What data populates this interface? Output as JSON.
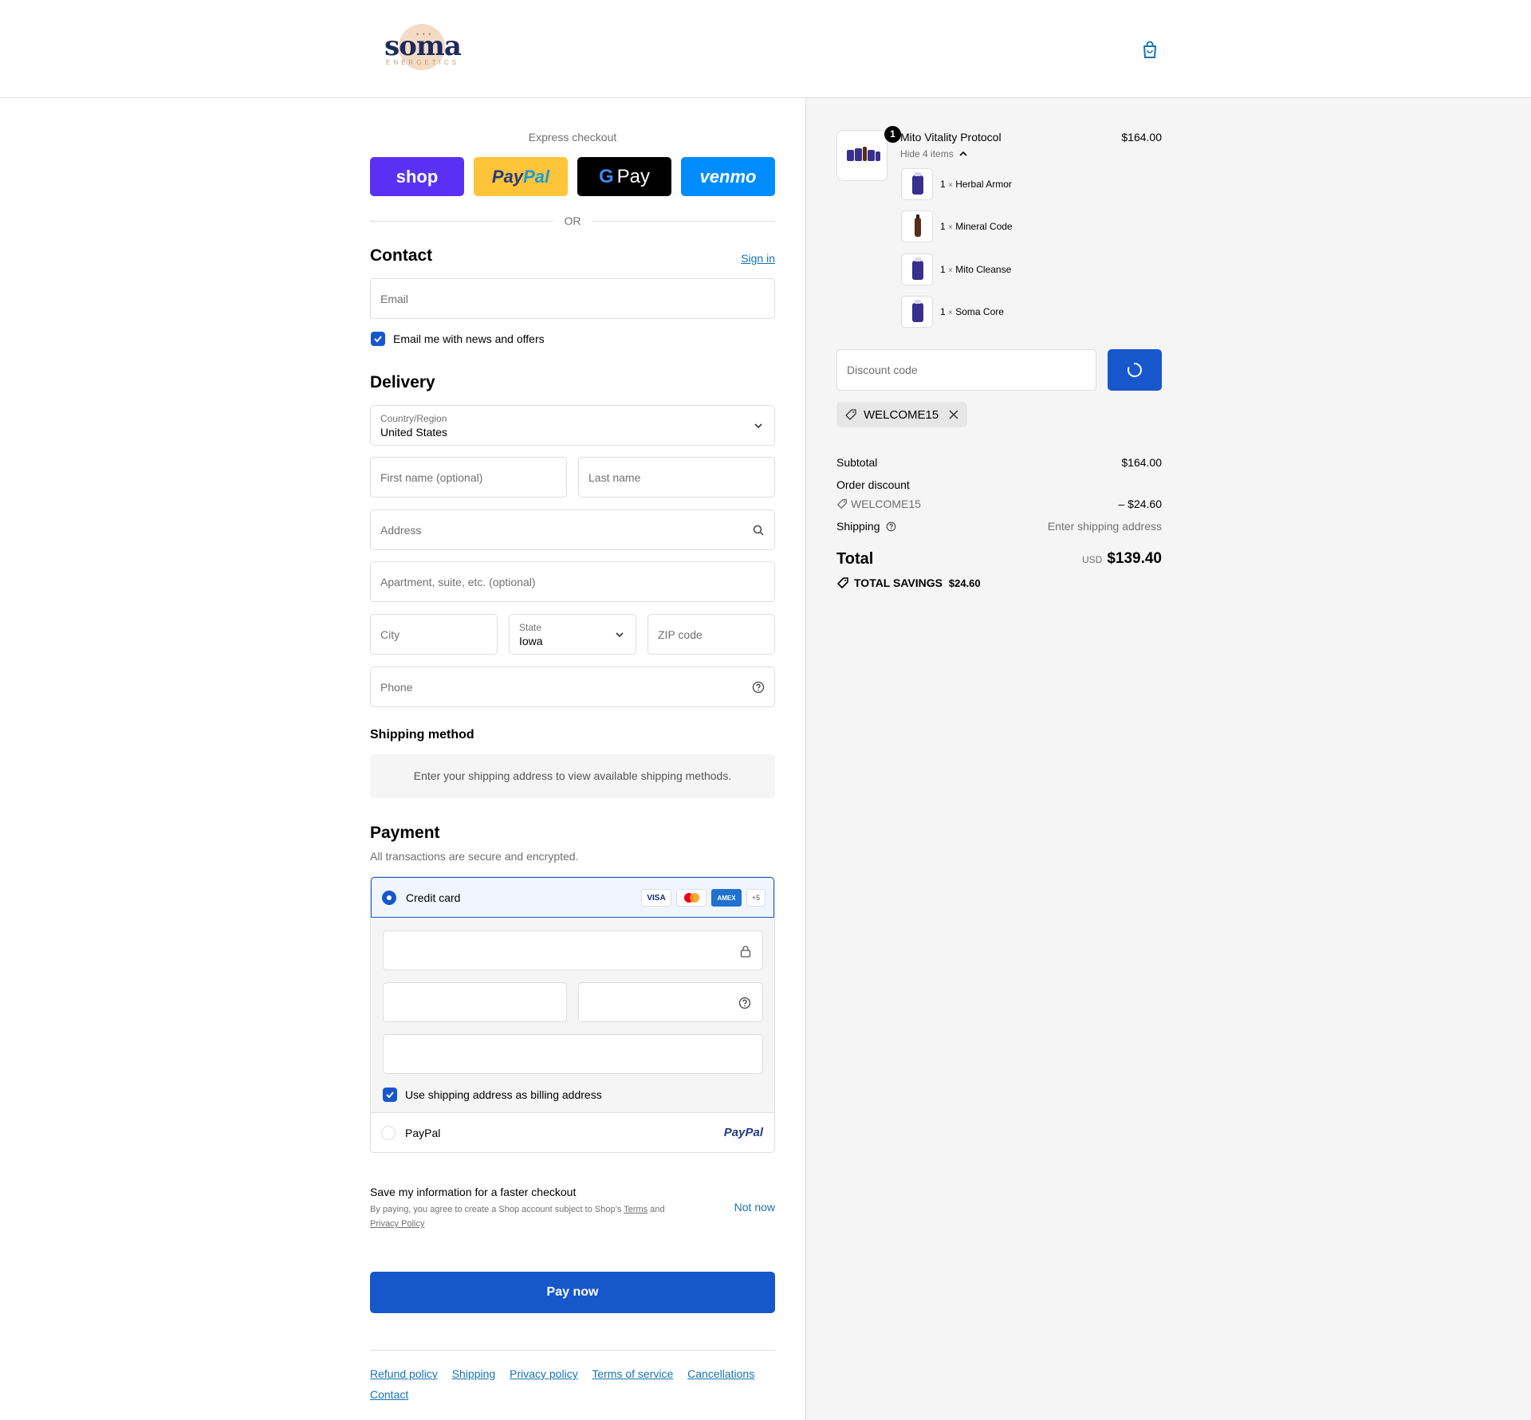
{
  "brand": {
    "logo_word": "soma",
    "logo_sub": "ENERGETICS"
  },
  "express": {
    "title": "Express checkout",
    "or": "OR",
    "buttons": {
      "shop": "shop",
      "paypal": "PayPal",
      "gpay": "Pay",
      "venmo": "venmo"
    }
  },
  "contact": {
    "title": "Contact",
    "sign_in": "Sign in",
    "email_placeholder": "Email",
    "news_label": "Email me with news and offers"
  },
  "delivery": {
    "title": "Delivery",
    "country_label": "Country/Region",
    "country_value": "United States",
    "first_name_placeholder": "First name (optional)",
    "last_name_placeholder": "Last name",
    "address_placeholder": "Address",
    "apartment_placeholder": "Apartment, suite, etc. (optional)",
    "city_placeholder": "City",
    "state_label": "State",
    "state_value": "Iowa",
    "zip_placeholder": "ZIP code",
    "phone_placeholder": "Phone"
  },
  "shipping_method": {
    "title": "Shipping method",
    "message": "Enter your shipping address to view available shipping methods."
  },
  "payment": {
    "title": "Payment",
    "subtitle": "All transactions are secure and encrypted.",
    "credit_card_label": "Credit card",
    "brands": {
      "visa": "VISA",
      "amex": "AMEX",
      "more": "+5"
    },
    "billing_label": "Use shipping address as billing address",
    "paypal_label": "PayPal",
    "paypal_logo": "PayPal"
  },
  "save_info": {
    "title": "Save my information for a faster checkout",
    "text_pre": "By paying, you agree to create a Shop account subject to Shop’s ",
    "terms": "Terms",
    "text_and": " and",
    "privacy": "Privacy Policy",
    "not_now": "Not now"
  },
  "pay_now": "Pay now",
  "footer_links": [
    "Refund policy",
    "Shipping",
    "Privacy policy",
    "Terms of service",
    "Cancellations",
    "Contact"
  ],
  "order": {
    "product": {
      "name": "Mito Vitality Protocol",
      "price": "$164.00",
      "quantity_badge": "1",
      "toggle": "Hide 4 items"
    },
    "items": [
      {
        "qty": "1",
        "times": "×",
        "name": "Herbal Armor"
      },
      {
        "qty": "1",
        "times": "×",
        "name": "Mineral Code"
      },
      {
        "qty": "1",
        "times": "×",
        "name": "Mito Cleanse"
      },
      {
        "qty": "1",
        "times": "×",
        "name": "Soma Core"
      }
    ],
    "discount_placeholder": "Discount code",
    "applied_code": "WELCOME15",
    "subtotal_label": "Subtotal",
    "subtotal_value": "$164.00",
    "order_discount_label": "Order discount",
    "discount_code": "WELCOME15",
    "discount_value": "– $24.60",
    "shipping_label": "Shipping",
    "shipping_value": "Enter shipping address",
    "total_label": "Total",
    "currency": "USD",
    "total_value": "$139.40",
    "savings_label": "TOTAL SAVINGS",
    "savings_value": "$24.60"
  },
  "colors": {
    "accent": "#1757cc",
    "shop": "#5a31f4",
    "paypal_bg": "#ffc439",
    "venmo": "#008cff"
  }
}
